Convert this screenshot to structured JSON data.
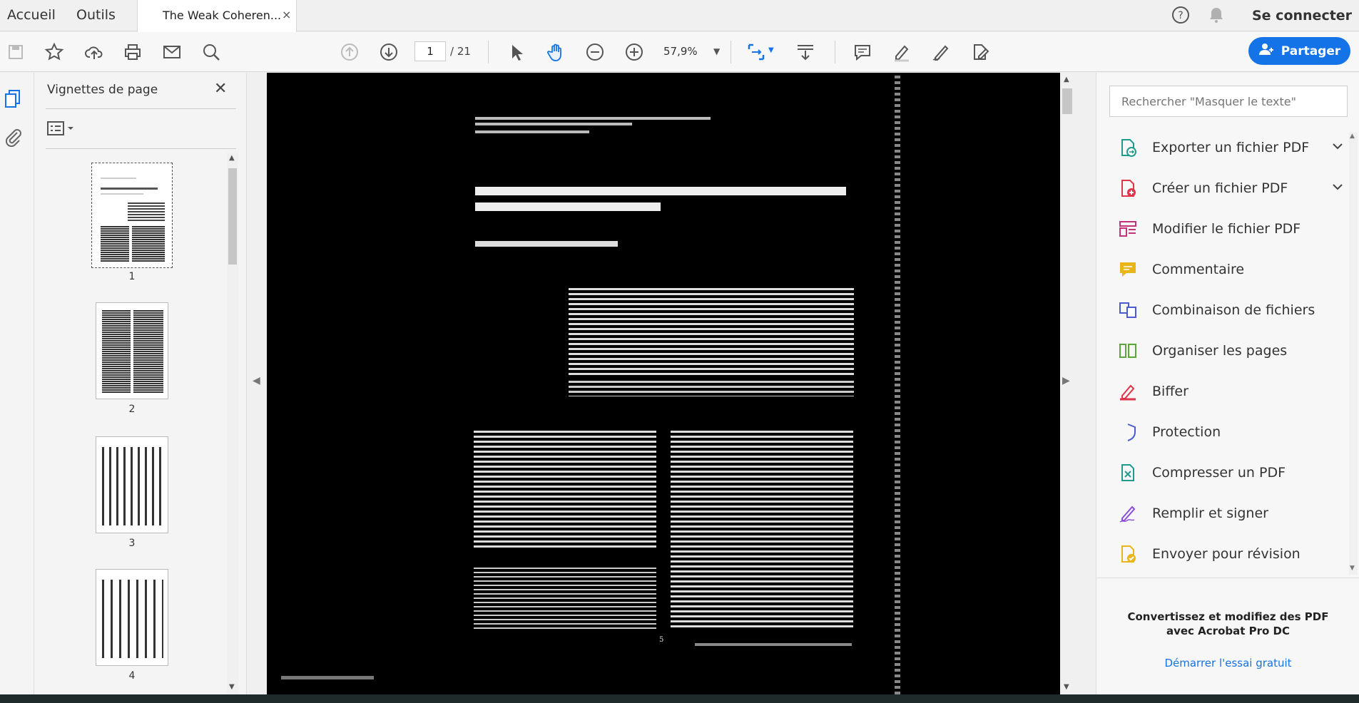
{
  "menu": {
    "home": "Accueil",
    "tools": "Outils"
  },
  "tab": {
    "title": "The Weak Coheren...",
    "close": "×"
  },
  "header": {
    "signin": "Se connecter"
  },
  "toolbar": {
    "page_current": "1",
    "page_total": "/ 21",
    "zoom": "57,9%",
    "share": "Partager"
  },
  "thumbs": {
    "title": "Vignettes de page",
    "close": "✕",
    "pages": [
      "1",
      "2",
      "3",
      "4"
    ]
  },
  "document": {
    "footer_left": "5",
    "page_num": "5"
  },
  "right": {
    "search_placeholder": "Rechercher \"Masquer le texte\"",
    "tools": [
      {
        "label": "Exporter un fichier PDF",
        "icon": "export-pdf-icon",
        "color": "#1f9b8e"
      },
      {
        "label": "Créer un fichier PDF",
        "icon": "create-pdf-icon",
        "color": "#e0344b"
      },
      {
        "label": "Modifier le fichier PDF",
        "icon": "edit-pdf-icon",
        "color": "#c2337a"
      },
      {
        "label": "Commentaire",
        "icon": "comment-icon",
        "color": "#e8b61a"
      },
      {
        "label": "Combinaison de fichiers",
        "icon": "combine-files-icon",
        "color": "#4a5bd4"
      },
      {
        "label": "Organiser les pages",
        "icon": "organize-pages-icon",
        "color": "#5aa63a"
      },
      {
        "label": "Biffer",
        "icon": "redact-icon",
        "color": "#e0344b"
      },
      {
        "label": "Protection",
        "icon": "protect-icon",
        "color": "#4a5bd4"
      },
      {
        "label": "Compresser un PDF",
        "icon": "compress-pdf-icon",
        "color": "#1f9b8e"
      },
      {
        "label": "Remplir et signer",
        "icon": "fill-sign-icon",
        "color": "#8a4fd6"
      },
      {
        "label": "Envoyer pour révision",
        "icon": "send-review-icon",
        "color": "#e8b61a"
      }
    ],
    "promo": "Convertissez et modifiez des PDF avec Acrobat Pro DC",
    "promo_line1": "Convertissez et modifiez des PDF",
    "promo_line2": "avec Acrobat Pro DC",
    "trial": "Démarrer l'essai gratuit"
  }
}
